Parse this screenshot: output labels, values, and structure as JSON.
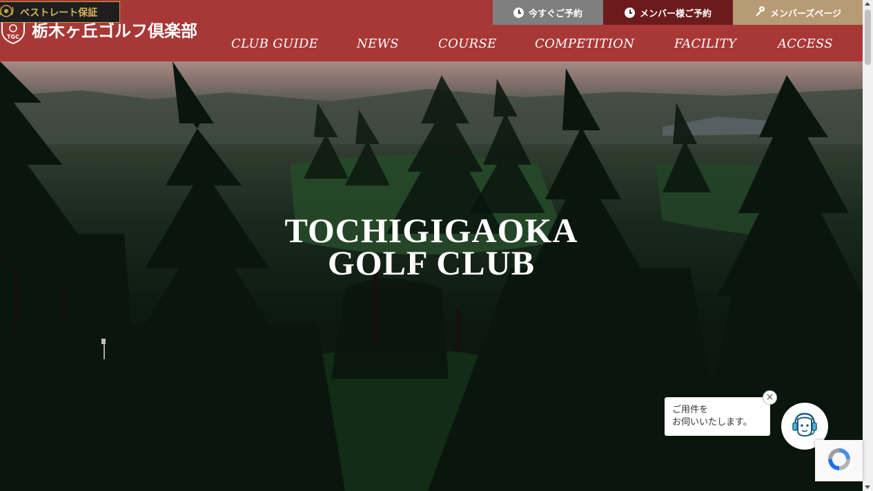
{
  "header": {
    "logo_text": "栃木ヶ丘ゴルフ倶楽部",
    "logo_monogram": "TGC",
    "background_color": "#a83836"
  },
  "utility": {
    "best_rate_label": "ベストレート保証",
    "reserve_now_label": "今すぐご予約",
    "member_reserve_label": "メンバー様ご予約",
    "member_page_label": "メンバーズページ"
  },
  "nav": {
    "items": [
      "CLUB GUIDE",
      "NEWS",
      "COURSE",
      "COMPETITION",
      "FACILITY",
      "ACCESS"
    ]
  },
  "hero": {
    "title_line1": "TOCHIGIGAOKA",
    "title_line2": "GOLF CLUB"
  },
  "chat": {
    "line1": "ご用件を",
    "line2": "お伺いいたします。"
  }
}
